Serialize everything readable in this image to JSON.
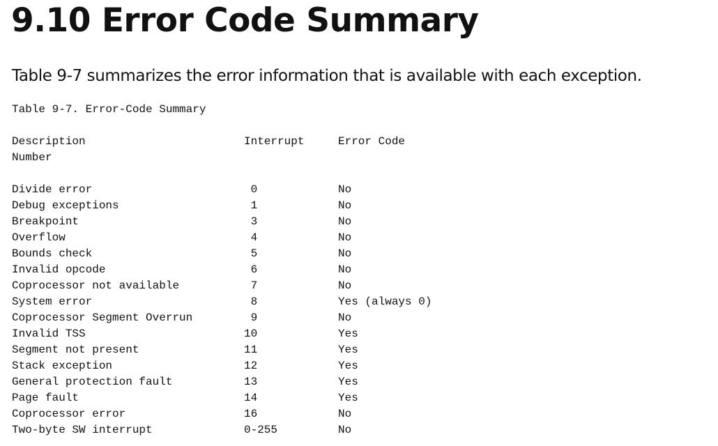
{
  "heading": "9.10 Error Code Summary",
  "intro": "Table 9-7 summarizes the error information that is available with each exception.",
  "table": {
    "caption": "Table 9-7. Error-Code Summary",
    "headers": {
      "description": "Description",
      "interrupt": "Interrupt",
      "error_code": "Error Code",
      "number": "Number"
    },
    "rows": [
      {
        "description": "Divide error",
        "interrupt": "0",
        "error_code": "No"
      },
      {
        "description": "Debug exceptions",
        "interrupt": "1",
        "error_code": "No"
      },
      {
        "description": "Breakpoint",
        "interrupt": "3",
        "error_code": "No"
      },
      {
        "description": "Overflow",
        "interrupt": "4",
        "error_code": "No"
      },
      {
        "description": "Bounds check",
        "interrupt": "5",
        "error_code": "No"
      },
      {
        "description": "Invalid opcode",
        "interrupt": "6",
        "error_code": "No"
      },
      {
        "description": "Coprocessor not available",
        "interrupt": "7",
        "error_code": "No"
      },
      {
        "description": "System error",
        "interrupt": "8",
        "error_code": "Yes (always 0)"
      },
      {
        "description": "Coprocessor Segment Overrun",
        "interrupt": "9",
        "error_code": "No"
      },
      {
        "description": "Invalid TSS",
        "interrupt": "10",
        "error_code": "Yes"
      },
      {
        "description": "Segment not present",
        "interrupt": "11",
        "error_code": "Yes"
      },
      {
        "description": "Stack exception",
        "interrupt": "12",
        "error_code": "Yes"
      },
      {
        "description": "General protection fault",
        "interrupt": "13",
        "error_code": "Yes"
      },
      {
        "description": "Page fault",
        "interrupt": "14",
        "error_code": "Yes"
      },
      {
        "description": "Coprocessor error",
        "interrupt": "16",
        "error_code": "No"
      },
      {
        "description": "Two-byte SW interrupt",
        "interrupt": "0-255",
        "error_code": "No"
      }
    ]
  }
}
